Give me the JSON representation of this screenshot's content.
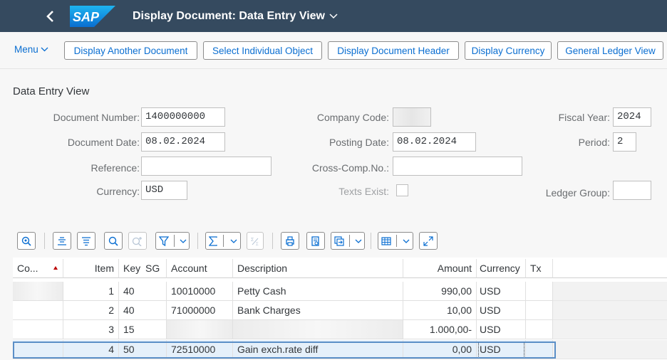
{
  "shell": {
    "back_icon": "chevron-left-icon",
    "logo_text": "SAP",
    "title": "Display Document: Data Entry View",
    "colors": {
      "shell_bg": "#354a5f",
      "link": "#0a6ed1",
      "selection": "#5b8fc7"
    }
  },
  "toolbar": {
    "menu_label": "Menu",
    "buttons": [
      "Display Another Document",
      "Select Individual Object",
      "Display Document Header",
      "Display Currency",
      "General Ledger View"
    ]
  },
  "header": {
    "section_title": "Data Entry View",
    "document_number_label": "Document Number:",
    "document_number": "1400000000",
    "company_code_label": "Company Code:",
    "company_code": "",
    "fiscal_year_label": "Fiscal Year:",
    "fiscal_year": "2024",
    "document_date_label": "Document Date:",
    "document_date": "08.02.2024",
    "posting_date_label": "Posting Date:",
    "posting_date": "08.02.2024",
    "period_label": "Period:",
    "period": "2",
    "reference_label": "Reference:",
    "reference": "",
    "cross_comp_label": "Cross-Comp.No.:",
    "cross_comp": "",
    "currency_label": "Currency:",
    "currency": "USD",
    "texts_exist_label": "Texts Exist:",
    "texts_exist_checked": false,
    "ledger_group_label": "Ledger Group:",
    "ledger_group": ""
  },
  "grid_toolbar": {
    "icons": [
      "details-icon",
      "align-center-icon",
      "align-justify-icon",
      "find-icon",
      "find-next-icon",
      "filter-icon",
      "sum-icon",
      "subtotal-icon",
      "print-icon",
      "print-preview-icon",
      "export-icon",
      "layout-icon",
      "maximize-icon"
    ]
  },
  "table": {
    "columns": [
      "Co...",
      "Item",
      "Key",
      "SG",
      "Account",
      "Description",
      "Amount",
      "Currency",
      "Tx"
    ],
    "rows": [
      {
        "co": "",
        "item": "1",
        "key": "40",
        "sg": "",
        "account": "10010000",
        "description": "Petty Cash",
        "amount": "990,00",
        "currency": "USD",
        "tx": ""
      },
      {
        "co": "",
        "item": "2",
        "key": "40",
        "sg": "",
        "account": "71000000",
        "description": "Bank Charges",
        "amount": "10,00",
        "currency": "USD",
        "tx": ""
      },
      {
        "co": "",
        "item": "3",
        "key": "15",
        "sg": "",
        "account": "",
        "description": "",
        "amount": "1.000,00-",
        "currency": "USD",
        "tx": ""
      },
      {
        "co": "",
        "item": "4",
        "key": "50",
        "sg": "",
        "account": "72510000",
        "description": "Gain exch.rate diff",
        "amount": "0,00",
        "currency": "USD",
        "tx": ""
      }
    ]
  }
}
